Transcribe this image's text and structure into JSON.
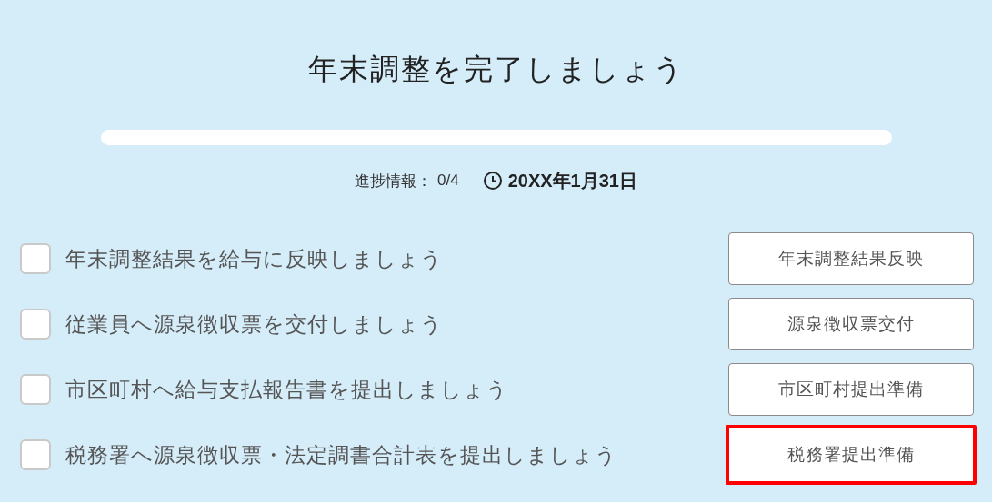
{
  "title": "年末調整を完了しましょう",
  "progress": {
    "level": 0,
    "label": "進捗情報：",
    "count": "0/4"
  },
  "deadline": "20XX年1月31日",
  "tasks": [
    {
      "text": "年末調整結果を給与に反映しましょう",
      "checked": false,
      "button": "年末調整結果反映",
      "highlighted": false
    },
    {
      "text": "従業員へ源泉徴収票を交付しましょう",
      "checked": false,
      "button": "源泉徴収票交付",
      "highlighted": false
    },
    {
      "text": "市区町村へ給与支払報告書を提出しましょう",
      "checked": false,
      "button": "市区町村提出準備",
      "highlighted": false
    },
    {
      "text": "税務署へ源泉徴収票・法定調書合計表を提出しましょう",
      "checked": false,
      "button": "税務署提出準備",
      "highlighted": true
    }
  ]
}
